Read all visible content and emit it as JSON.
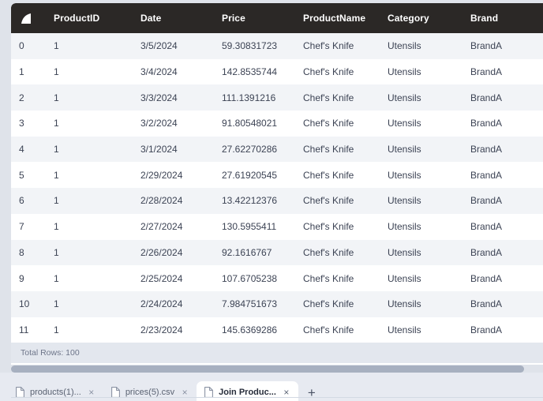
{
  "table": {
    "logo_icon": "sail-icon",
    "columns": [
      {
        "key": "index",
        "label": ""
      },
      {
        "key": "ProductID",
        "label": "ProductID"
      },
      {
        "key": "Date",
        "label": "Date"
      },
      {
        "key": "Price",
        "label": "Price"
      },
      {
        "key": "ProductName",
        "label": "ProductName"
      },
      {
        "key": "Category",
        "label": "Category"
      },
      {
        "key": "Brand",
        "label": "Brand"
      }
    ],
    "rows": [
      {
        "index": "0",
        "ProductID": "1",
        "Date": "3/5/2024",
        "Price": "59.30831723",
        "ProductName": "Chef's Knife",
        "Category": "Utensils",
        "Brand": "BrandA"
      },
      {
        "index": "1",
        "ProductID": "1",
        "Date": "3/4/2024",
        "Price": "142.8535744",
        "ProductName": "Chef's Knife",
        "Category": "Utensils",
        "Brand": "BrandA"
      },
      {
        "index": "2",
        "ProductID": "1",
        "Date": "3/3/2024",
        "Price": "111.1391216",
        "ProductName": "Chef's Knife",
        "Category": "Utensils",
        "Brand": "BrandA"
      },
      {
        "index": "3",
        "ProductID": "1",
        "Date": "3/2/2024",
        "Price": "91.80548021",
        "ProductName": "Chef's Knife",
        "Category": "Utensils",
        "Brand": "BrandA"
      },
      {
        "index": "4",
        "ProductID": "1",
        "Date": "3/1/2024",
        "Price": "27.62270286",
        "ProductName": "Chef's Knife",
        "Category": "Utensils",
        "Brand": "BrandA"
      },
      {
        "index": "5",
        "ProductID": "1",
        "Date": "2/29/2024",
        "Price": "27.61920545",
        "ProductName": "Chef's Knife",
        "Category": "Utensils",
        "Brand": "BrandA"
      },
      {
        "index": "6",
        "ProductID": "1",
        "Date": "2/28/2024",
        "Price": "13.42212376",
        "ProductName": "Chef's Knife",
        "Category": "Utensils",
        "Brand": "BrandA"
      },
      {
        "index": "7",
        "ProductID": "1",
        "Date": "2/27/2024",
        "Price": "130.5955411",
        "ProductName": "Chef's Knife",
        "Category": "Utensils",
        "Brand": "BrandA"
      },
      {
        "index": "8",
        "ProductID": "1",
        "Date": "2/26/2024",
        "Price": "92.1616767",
        "ProductName": "Chef's Knife",
        "Category": "Utensils",
        "Brand": "BrandA"
      },
      {
        "index": "9",
        "ProductID": "1",
        "Date": "2/25/2024",
        "Price": "107.6705238",
        "ProductName": "Chef's Knife",
        "Category": "Utensils",
        "Brand": "BrandA"
      },
      {
        "index": "10",
        "ProductID": "1",
        "Date": "2/24/2024",
        "Price": "7.984751673",
        "ProductName": "Chef's Knife",
        "Category": "Utensils",
        "Brand": "BrandA"
      },
      {
        "index": "11",
        "ProductID": "1",
        "Date": "2/23/2024",
        "Price": "145.6369286",
        "ProductName": "Chef's Knife",
        "Category": "Utensils",
        "Brand": "BrandA"
      }
    ],
    "footer": {
      "total_rows_label": "Total Rows: 100"
    }
  },
  "tabbar": {
    "tabs": [
      {
        "label": "products(1)...",
        "icon": "document-icon",
        "close_icon": "×",
        "active": false
      },
      {
        "label": "prices(5).csv",
        "icon": "document-icon",
        "close_icon": "×",
        "active": false
      },
      {
        "label": "Join Produc...",
        "icon": "document-icon",
        "close_icon": "×",
        "active": true
      }
    ],
    "add_tab_label": "+"
  },
  "colors": {
    "header_bg": "#2b2826",
    "row_even": "#f2f4f7",
    "row_odd": "#ffffff",
    "page_bg": "#dfe3ea",
    "footer_bg": "#e3e7ee",
    "scrollbar_thumb": "#a7b0c0",
    "tabbar_bg": "#e7eaf1",
    "active_tab_bg": "#ffffff",
    "text": "#3c4354"
  }
}
